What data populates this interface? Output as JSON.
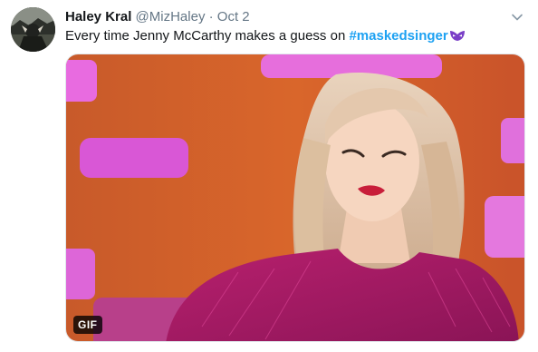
{
  "tweet": {
    "display_name": "Haley Kral",
    "handle": "@MizHaley",
    "separator": "·",
    "date": "Oct 2",
    "text_before": "Every time Jenny McCarthy makes a guess on ",
    "hashtag": "#maskedsinger",
    "hashflag_icon": "masked-singer-mask-icon",
    "media_badge": "GIF"
  },
  "icons": {
    "menu": "chevron-down-icon",
    "hashflag": "mask-icon"
  },
  "colors": {
    "hashtag": "#1da1f2",
    "name": "#14171a",
    "muted": "#657786",
    "hashflag_purple": "#7a3fc7"
  }
}
